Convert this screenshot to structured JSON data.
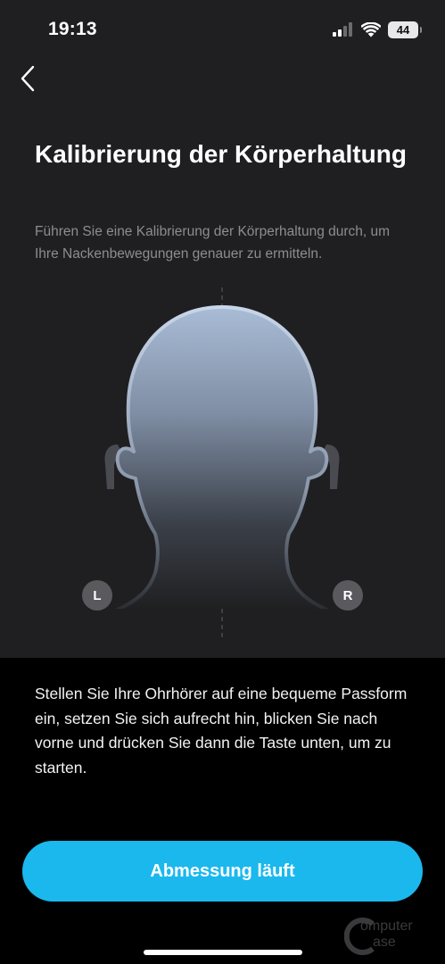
{
  "status_bar": {
    "time": "19:13",
    "battery_level": "44",
    "icons": [
      "signal-icon",
      "wifi-icon",
      "battery-icon"
    ]
  },
  "nav": {
    "back_icon": "chevron-left-icon"
  },
  "header": {
    "title": "Kalibrierung der Körperhaltung",
    "subtitle": "Führen Sie eine Kalibrierung der Körperhaltung durch, um Ihre Nackenbewegungen genauer zu ermitteln."
  },
  "illustration": {
    "left_label": "L",
    "right_label": "R"
  },
  "instructions": {
    "text": "Stellen Sie Ihre Ohrhörer auf eine bequeme Passform ein, setzen Sie sich aufrecht hin, blicken Sie nach vorne und drücken Sie dann die Taste unten, um zu starten."
  },
  "action": {
    "button_label": "Abmessung läuft"
  },
  "watermark": {
    "line1": "omputer",
    "line2": "ase"
  },
  "colors": {
    "accent": "#1bb8ee",
    "top_background": "#1f1f21",
    "bottom_background": "#000000",
    "subtitle_text": "#8d8d91"
  }
}
